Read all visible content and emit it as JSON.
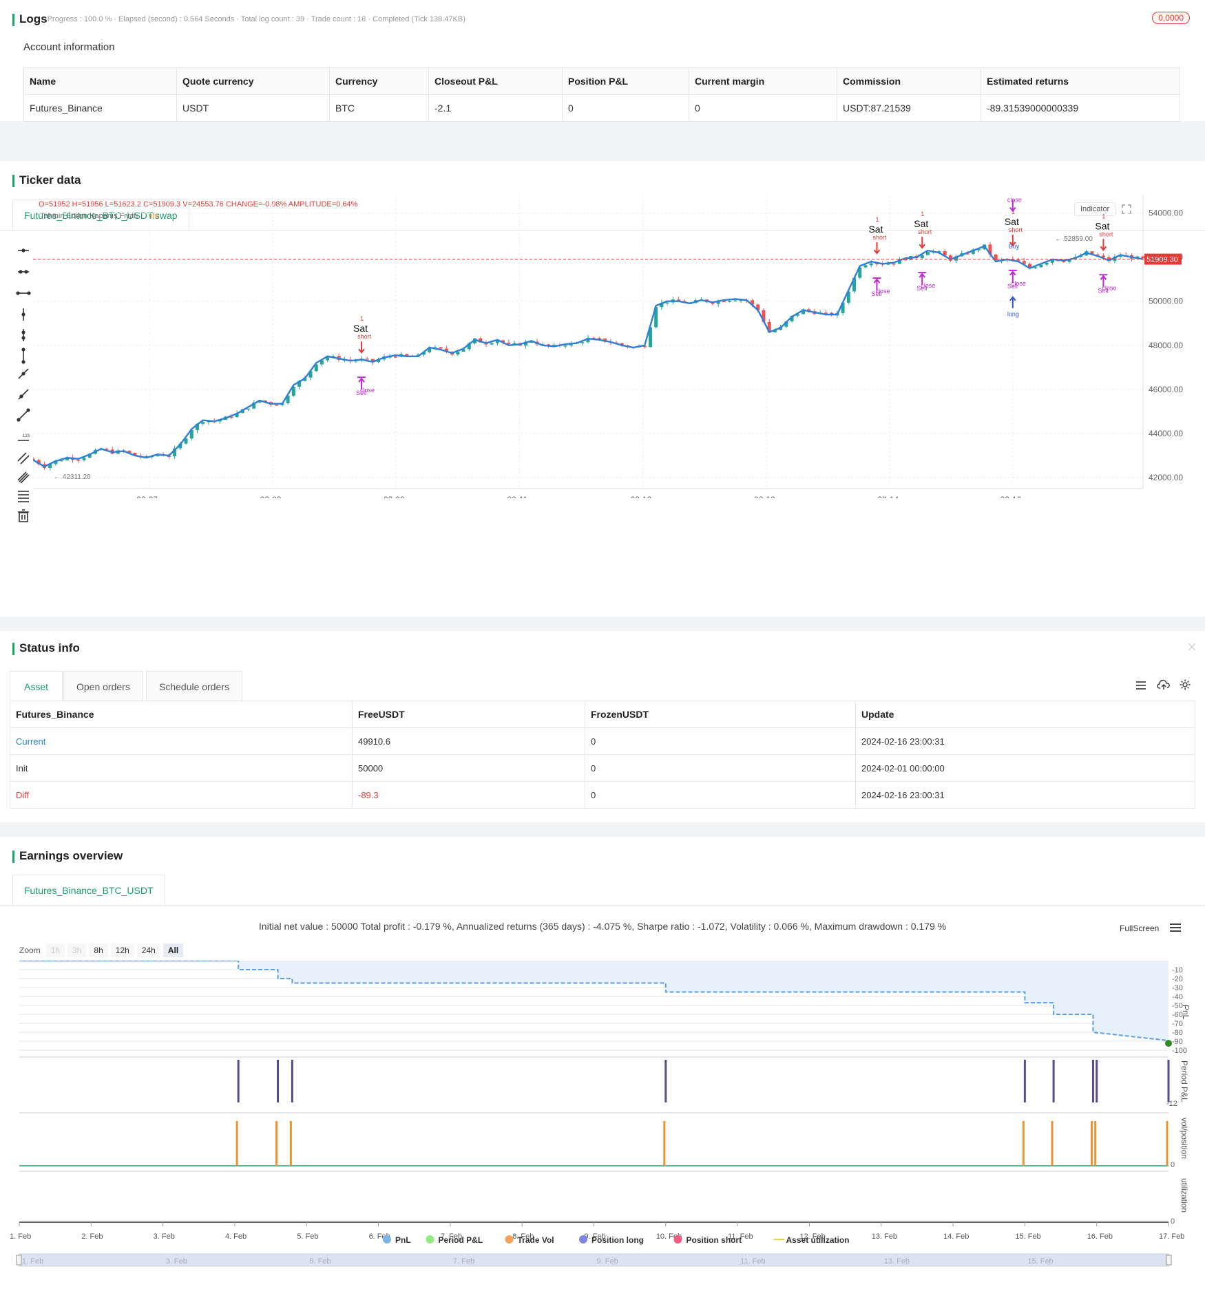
{
  "logs": {
    "title": "Logs",
    "status": "· Progress : 100.0 % · Elapsed (second) : 0.564 Seconds · Total log count : 39 · Trade count : 18 · Completed (Tick 138.47KB)",
    "badge": "0.0000"
  },
  "account": {
    "title": "Account information",
    "headers": [
      "Name",
      "Quote currency",
      "Currency",
      "Closeout P&L",
      "Position P&L",
      "Current margin",
      "Commission",
      "Estimated returns"
    ],
    "row": [
      "Futures_Binance",
      "USDT",
      "BTC",
      "-2.1",
      "0",
      "0",
      "USDT:87.21539",
      "-89.31539000000339"
    ]
  },
  "ticker": {
    "title": "Ticker data",
    "tab": "Futures_Binance_BTC_USDT:swap",
    "ohlc": {
      "o": "O=51952",
      "h": "H=51956",
      "l": "L=51623.2",
      "c": "C=51909.3",
      "v": "V=24553.76",
      "change_label": "CHANGE=",
      "change": "-0.08%",
      "amp_label": "AMPLITUDE=",
      "amp": "0.64%"
    },
    "indicator_name": "Tahmin Edilen Kapanış Fiyatı",
    "indicator_value": "n/a",
    "indicator_button": "Indicator",
    "last_price": "51909.30",
    "low_label": "42311.20",
    "high_label": "52859.00",
    "y_ticks": [
      "54000.00",
      "52000.00",
      "50000.00",
      "48000.00",
      "46000.00",
      "44000.00",
      "42000.00"
    ],
    "x_ticks": [
      "02-07",
      "02-08",
      "02-09",
      "02-11",
      "02-12",
      "02-13",
      "02-14",
      "02-16"
    ],
    "colors": {
      "up": "#26a69a",
      "down": "#ef5350",
      "line": "#2e7fd8",
      "sell": "#e53935",
      "close": "#c026d3",
      "buy": "#2f55d4"
    },
    "annotations": {
      "sat": "Sat",
      "short": "short",
      "close": "close",
      "sell": "Sell",
      "buy": "Buy",
      "long": "long",
      "one": "1"
    }
  },
  "chart_data": {
    "type": "candlestick",
    "x_ticks": [
      "02-07",
      "02-08",
      "02-09",
      "02-11",
      "02-12",
      "02-13",
      "02-14",
      "02-16"
    ],
    "ylim": [
      41500,
      54800
    ],
    "close_path": [
      [
        0,
        42800
      ],
      [
        2,
        42500
      ],
      [
        4,
        42750
      ],
      [
        6,
        42900
      ],
      [
        8,
        42850
      ],
      [
        10,
        43050
      ],
      [
        12,
        43300
      ],
      [
        14,
        43150
      ],
      [
        16,
        43200
      ],
      [
        18,
        43000
      ],
      [
        20,
        42900
      ],
      [
        22,
        43050
      ],
      [
        24,
        43000
      ],
      [
        26,
        43500
      ],
      [
        28,
        44200
      ],
      [
        30,
        44600
      ],
      [
        32,
        44550
      ],
      [
        34,
        44700
      ],
      [
        36,
        44900
      ],
      [
        38,
        45200
      ],
      [
        40,
        45500
      ],
      [
        42,
        45350
      ],
      [
        44,
        45350
      ],
      [
        46,
        46200
      ],
      [
        48,
        46500
      ],
      [
        50,
        47200
      ],
      [
        52,
        47500
      ],
      [
        54,
        47400
      ],
      [
        56,
        47300
      ],
      [
        58,
        47350
      ],
      [
        60,
        47250
      ],
      [
        62,
        47450
      ],
      [
        64,
        47550
      ],
      [
        66,
        47500
      ],
      [
        68,
        47500
      ],
      [
        70,
        47900
      ],
      [
        72,
        47800
      ],
      [
        74,
        47650
      ],
      [
        76,
        47850
      ],
      [
        78,
        48250
      ],
      [
        80,
        48100
      ],
      [
        82,
        48250
      ],
      [
        84,
        48000
      ],
      [
        86,
        48050
      ],
      [
        88,
        48200
      ],
      [
        90,
        48000
      ],
      [
        92,
        47950
      ],
      [
        94,
        48050
      ],
      [
        96,
        48100
      ],
      [
        98,
        48300
      ],
      [
        100,
        48250
      ],
      [
        102,
        48150
      ],
      [
        104,
        48000
      ],
      [
        106,
        47900
      ],
      [
        108,
        48000
      ],
      [
        110,
        49800
      ],
      [
        112,
        50000
      ],
      [
        114,
        50000
      ],
      [
        116,
        49900
      ],
      [
        118,
        50050
      ],
      [
        120,
        49950
      ],
      [
        122,
        50050
      ],
      [
        124,
        50100
      ],
      [
        126,
        50050
      ],
      [
        128,
        49600
      ],
      [
        130,
        48600
      ],
      [
        132,
        48800
      ],
      [
        134,
        49300
      ],
      [
        136,
        49600
      ],
      [
        138,
        49500
      ],
      [
        140,
        49400
      ],
      [
        142,
        49400
      ],
      [
        144,
        50500
      ],
      [
        146,
        51600
      ],
      [
        148,
        51800
      ],
      [
        150,
        51700
      ],
      [
        152,
        51750
      ],
      [
        154,
        51950
      ],
      [
        156,
        52000
      ],
      [
        158,
        52300
      ],
      [
        160,
        52200
      ],
      [
        162,
        51900
      ],
      [
        164,
        52100
      ],
      [
        166,
        52300
      ],
      [
        168,
        52500
      ],
      [
        170,
        51800
      ],
      [
        172,
        51900
      ],
      [
        174,
        51800
      ],
      [
        176,
        51500
      ],
      [
        178,
        51700
      ],
      [
        180,
        51900
      ],
      [
        182,
        51850
      ],
      [
        184,
        51950
      ],
      [
        186,
        52200
      ],
      [
        188,
        52050
      ],
      [
        190,
        51850
      ],
      [
        192,
        52100
      ],
      [
        194,
        52000
      ],
      [
        196,
        51909
      ]
    ]
  },
  "status": {
    "title": "Status info",
    "tabs": [
      "Asset",
      "Open orders",
      "Schedule orders"
    ],
    "headers": [
      "Futures_Binance",
      "FreeUSDT",
      "FrozenUSDT",
      "Update"
    ],
    "rows": [
      [
        "Current",
        "49910.6",
        "0",
        "2024-02-16 23:00:31"
      ],
      [
        "Init",
        "50000",
        "0",
        "2024-02-01 00:00:00"
      ],
      [
        "Diff",
        "-89.3",
        "0",
        "2024-02-16 23:00:31"
      ]
    ]
  },
  "earnings": {
    "title": "Earnings overview",
    "tab": "Futures_Binance_BTC_USDT",
    "summary": "Initial net value : 50000 Total profit : -0.179 %, Annualized returns (365 days) : -4.075 %, Sharpe ratio : -1.072, Volatility : 0.066 %, Maximum drawdown : 0.179 %",
    "fullscreen": "FullScreen",
    "zoom_label": "Zoom",
    "zoom_options": [
      "1h",
      "3h",
      "8h",
      "12h",
      "24h",
      "All"
    ],
    "pnl_ticks": [
      "-10",
      "-20",
      "-30",
      "-40",
      "-50",
      "-60",
      "-70",
      "-80",
      "-90",
      "-100"
    ],
    "axis_labels": [
      "PnL",
      "Period P&L",
      "vol/position",
      "utilization"
    ],
    "period_tick": "-12",
    "vol_tick": "0",
    "util_tick": "0",
    "x_ticks": [
      "1. Feb",
      "2. Feb",
      "3. Feb",
      "4. Feb",
      "5. Feb",
      "6. Feb",
      "7. Feb",
      "8. Feb",
      "9. Feb",
      "10. Feb",
      "11. Feb",
      "12. Feb",
      "13. Feb",
      "14. Feb",
      "15. Feb",
      "16. Feb",
      "17. Feb"
    ],
    "nav_ticks": [
      "1. Feb",
      "3. Feb",
      "5. Feb",
      "7. Feb",
      "9. Feb",
      "11. Feb",
      "13. Feb",
      "15. Feb"
    ],
    "legend": [
      {
        "label": "PnL",
        "color": "#7cb5ec"
      },
      {
        "label": "Period P&L",
        "color": "#90ed7d"
      },
      {
        "label": "Trade Vol",
        "color": "#f7a35c"
      },
      {
        "label": "Position long",
        "color": "#8085e9"
      },
      {
        "label": "Position short",
        "color": "#f15c80"
      },
      {
        "label": "Asset utilization",
        "color": "#e4d354"
      }
    ],
    "pnl_series": [
      [
        0,
        0
      ],
      [
        3.05,
        0
      ],
      [
        3.05,
        -10
      ],
      [
        3.6,
        -10
      ],
      [
        3.6,
        -20
      ],
      [
        3.8,
        -20
      ],
      [
        3.8,
        -25
      ],
      [
        9.0,
        -25
      ],
      [
        9.0,
        -35
      ],
      [
        14.0,
        -35
      ],
      [
        14.0,
        -47
      ],
      [
        14.4,
        -47
      ],
      [
        14.4,
        -60
      ],
      [
        14.95,
        -60
      ],
      [
        14.95,
        -80
      ],
      [
        16.0,
        -89.3
      ]
    ],
    "trade_days": [
      3.05,
      3.6,
      3.8,
      9.0,
      14.0,
      14.4,
      14.95,
      15.0,
      16.0
    ]
  }
}
